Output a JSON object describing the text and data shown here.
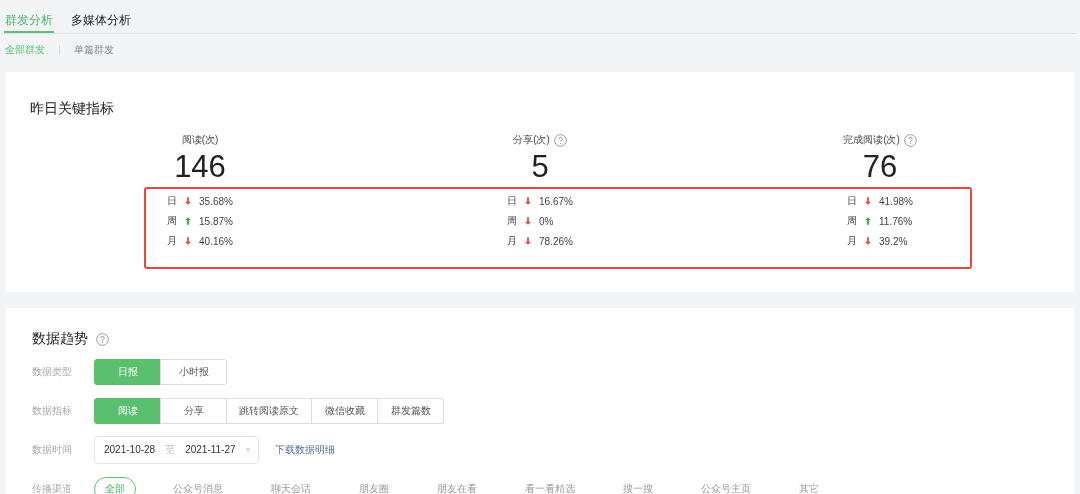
{
  "tabs": [
    {
      "label": "群发分析",
      "selected": true
    },
    {
      "label": "多媒体分析",
      "selected": false
    }
  ],
  "sub_tabs": [
    {
      "label": "全部群发",
      "selected": true
    },
    {
      "label": "单篇群发",
      "selected": false
    }
  ],
  "key_metrics": {
    "title": "昨日关键指标",
    "metrics": [
      {
        "label": "阅读(次)",
        "value": "146",
        "changes": [
          {
            "period": "日",
            "up": false,
            "percent": "35.68%"
          },
          {
            "period": "周",
            "up": true,
            "percent": "15.87%"
          },
          {
            "period": "月",
            "up": false,
            "percent": "40.16%"
          }
        ]
      },
      {
        "label": "分享(次)",
        "help": true,
        "value": "5",
        "changes": [
          {
            "period": "日",
            "up": false,
            "percent": "16.67%"
          },
          {
            "period": "周",
            "up": false,
            "percent": "0%"
          },
          {
            "period": "月",
            "up": false,
            "percent": "78.26%"
          }
        ]
      },
      {
        "label": "完成阅读(次)",
        "help": true,
        "value": "76",
        "changes": [
          {
            "period": "日",
            "up": false,
            "percent": "41.98%"
          },
          {
            "period": "周",
            "up": true,
            "percent": "11.76%"
          },
          {
            "period": "月",
            "up": false,
            "percent": "39.2%"
          }
        ]
      }
    ]
  },
  "trend": {
    "title": "数据趋势",
    "help": true,
    "filters": [
      {
        "kind": "segmented",
        "label": "数据类型",
        "options": [
          {
            "label": "日报",
            "selected": true
          },
          {
            "label": "小时报",
            "selected": false
          }
        ]
      },
      {
        "kind": "segmented",
        "label": "数据指标",
        "options": [
          {
            "label": "阅读",
            "selected": true
          },
          {
            "label": "分享",
            "selected": false
          },
          {
            "label": "跳转阅读原文",
            "selected": false
          },
          {
            "label": "微信收藏",
            "selected": false
          },
          {
            "label": "群发篇数",
            "selected": false
          }
        ]
      },
      {
        "kind": "date_range",
        "label": "数据时间",
        "start": "2021-10-28",
        "separator": "至",
        "end": "2021-11-27",
        "link": "下载数据明细"
      },
      {
        "kind": "chips",
        "label": "传播渠道",
        "options": [
          {
            "label": "全部",
            "selected": true
          },
          {
            "label": "公众号消息",
            "selected": false
          },
          {
            "label": "聊天会话",
            "selected": false
          },
          {
            "label": "朋友圈",
            "selected": false
          },
          {
            "label": "朋友在看",
            "selected": false
          },
          {
            "label": "看一看精选",
            "selected": false
          },
          {
            "label": "搜一搜",
            "selected": false
          },
          {
            "label": "公众号主页",
            "selected": false
          },
          {
            "label": "其它",
            "selected": false
          }
        ]
      }
    ]
  }
}
